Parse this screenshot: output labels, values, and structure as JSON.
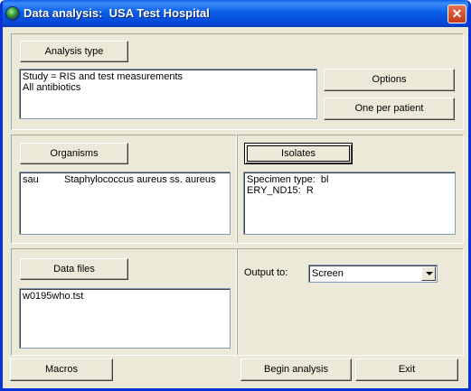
{
  "window": {
    "title": "Data analysis:  USA Test Hospital",
    "close_symbol": "✕"
  },
  "analysis": {
    "button_label": "Analysis type",
    "lines": [
      "Study = RIS and test measurements",
      "All antibiotics"
    ],
    "options_label": "Options",
    "one_per_patient_label": "One per patient"
  },
  "organisms": {
    "button_label": "Organisms",
    "items": [
      {
        "code": "sau",
        "name": "Staphylococcus aureus ss. aureus"
      }
    ]
  },
  "isolates": {
    "button_label": "Isolates",
    "lines": [
      "Specimen type:  bl",
      "ERY_ND15:  R"
    ]
  },
  "data_files": {
    "button_label": "Data files",
    "items": [
      "w0195who.tst"
    ]
  },
  "output": {
    "label": "Output to:",
    "selected": "Screen"
  },
  "footer": {
    "macros_label": "Macros",
    "begin_label": "Begin analysis",
    "exit_label": "Exit"
  },
  "icons": {
    "app": "globe-icon",
    "close": "close-icon",
    "dropdown": "chevron-down-icon"
  },
  "colors": {
    "titlebar": "#0A5FE8",
    "dialog_bg": "#ECE9D8",
    "close_btn": "#D9542B"
  }
}
